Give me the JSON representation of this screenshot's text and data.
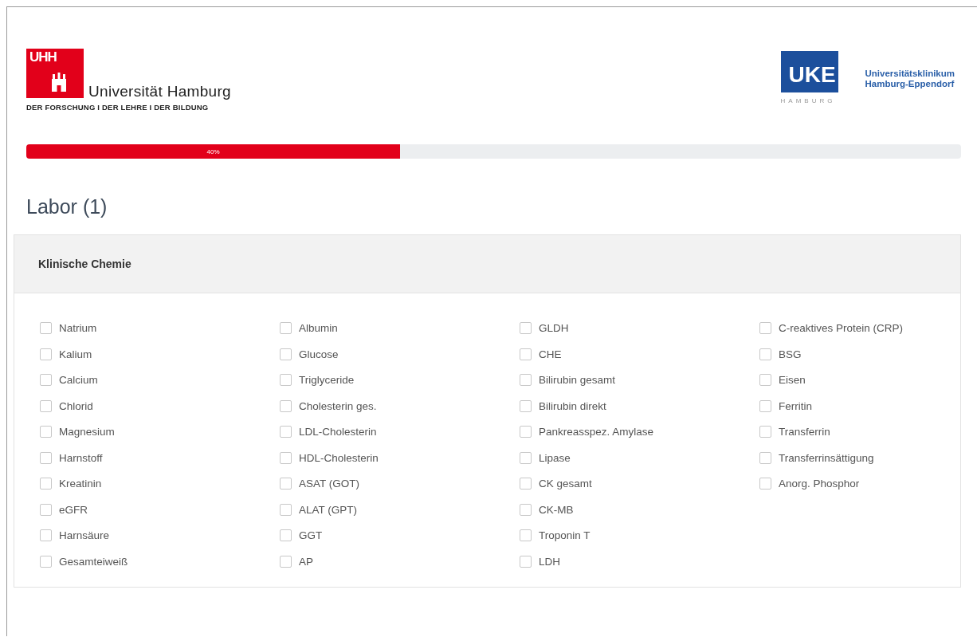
{
  "header": {
    "left_logo": {
      "mark": "UHH",
      "name": "Universität Hamburg",
      "tagline": "DER FORSCHUNG  I  DER LEHRE  I  DER BILDUNG"
    },
    "right_logo": {
      "mark": "UKE",
      "city": "HAMBURG",
      "name_lines": [
        "Universitätsklinikum",
        "Hamburg-Eppendorf"
      ]
    }
  },
  "progress": {
    "level": 0.4,
    "label": "40%"
  },
  "page_title": "Labor (1)",
  "panel": {
    "title": "Klinische Chemie",
    "columns": [
      [
        {
          "label": "Natrium",
          "checked": false
        },
        {
          "label": "Kalium",
          "checked": false
        },
        {
          "label": "Calcium",
          "checked": false
        },
        {
          "label": "Chlorid",
          "checked": false
        },
        {
          "label": "Magnesium",
          "checked": false
        },
        {
          "label": "Harnstoff",
          "checked": false
        },
        {
          "label": "Kreatinin",
          "checked": false
        },
        {
          "label": "eGFR",
          "checked": false
        },
        {
          "label": "Harnsäure",
          "checked": false
        },
        {
          "label": "Gesamteiweiß",
          "checked": false
        }
      ],
      [
        {
          "label": "Albumin",
          "checked": false
        },
        {
          "label": "Glucose",
          "checked": false
        },
        {
          "label": "Triglyceride",
          "checked": false
        },
        {
          "label": "Cholesterin ges.",
          "checked": false
        },
        {
          "label": "LDL-Cholesterin",
          "checked": false
        },
        {
          "label": "HDL-Cholesterin",
          "checked": false
        },
        {
          "label": "ASAT (GOT)",
          "checked": false
        },
        {
          "label": "ALAT (GPT)",
          "checked": false
        },
        {
          "label": "GGT",
          "checked": false
        },
        {
          "label": "AP",
          "checked": false
        }
      ],
      [
        {
          "label": "GLDH",
          "checked": false
        },
        {
          "label": "CHE",
          "checked": false
        },
        {
          "label": "Bilirubin gesamt",
          "checked": false
        },
        {
          "label": "Bilirubin direkt",
          "checked": false
        },
        {
          "label": "Pankreasspez. Amylase",
          "checked": false
        },
        {
          "label": "Lipase",
          "checked": false
        },
        {
          "label": "CK gesamt",
          "checked": false
        },
        {
          "label": "CK-MB",
          "checked": false
        },
        {
          "label": "Troponin T",
          "checked": false
        },
        {
          "label": "LDH",
          "checked": false
        }
      ],
      [
        {
          "label": "C-reaktives Protein (CRP)",
          "checked": false
        },
        {
          "label": "BSG",
          "checked": false
        },
        {
          "label": "Eisen",
          "checked": false
        },
        {
          "label": "Ferritin",
          "checked": false
        },
        {
          "label": "Transferrin",
          "checked": false
        },
        {
          "label": "Transferrinsättigung",
          "checked": false
        },
        {
          "label": "Anorg. Phosphor",
          "checked": false
        }
      ]
    ]
  }
}
